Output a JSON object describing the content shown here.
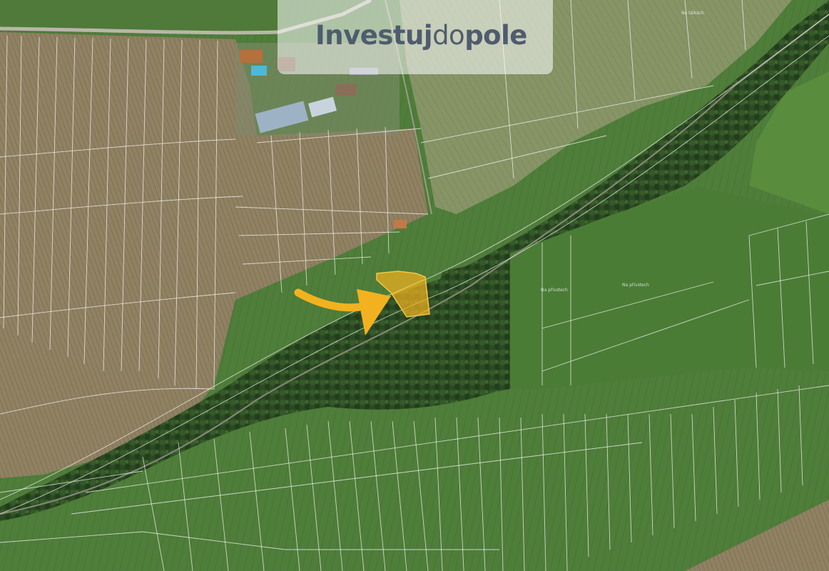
{
  "brand": {
    "part_investuj": "Investuj",
    "part_do": "do",
    "part_pole": "pole",
    "text_color": "#4f5c6d"
  },
  "map": {
    "type": "satellite cadastral map",
    "highlight_color": "#f2b21f",
    "arrow_color": "#f2b21f",
    "place_labels": [
      "Na přivstech",
      "Na přivstech",
      "Na tálkách"
    ]
  }
}
